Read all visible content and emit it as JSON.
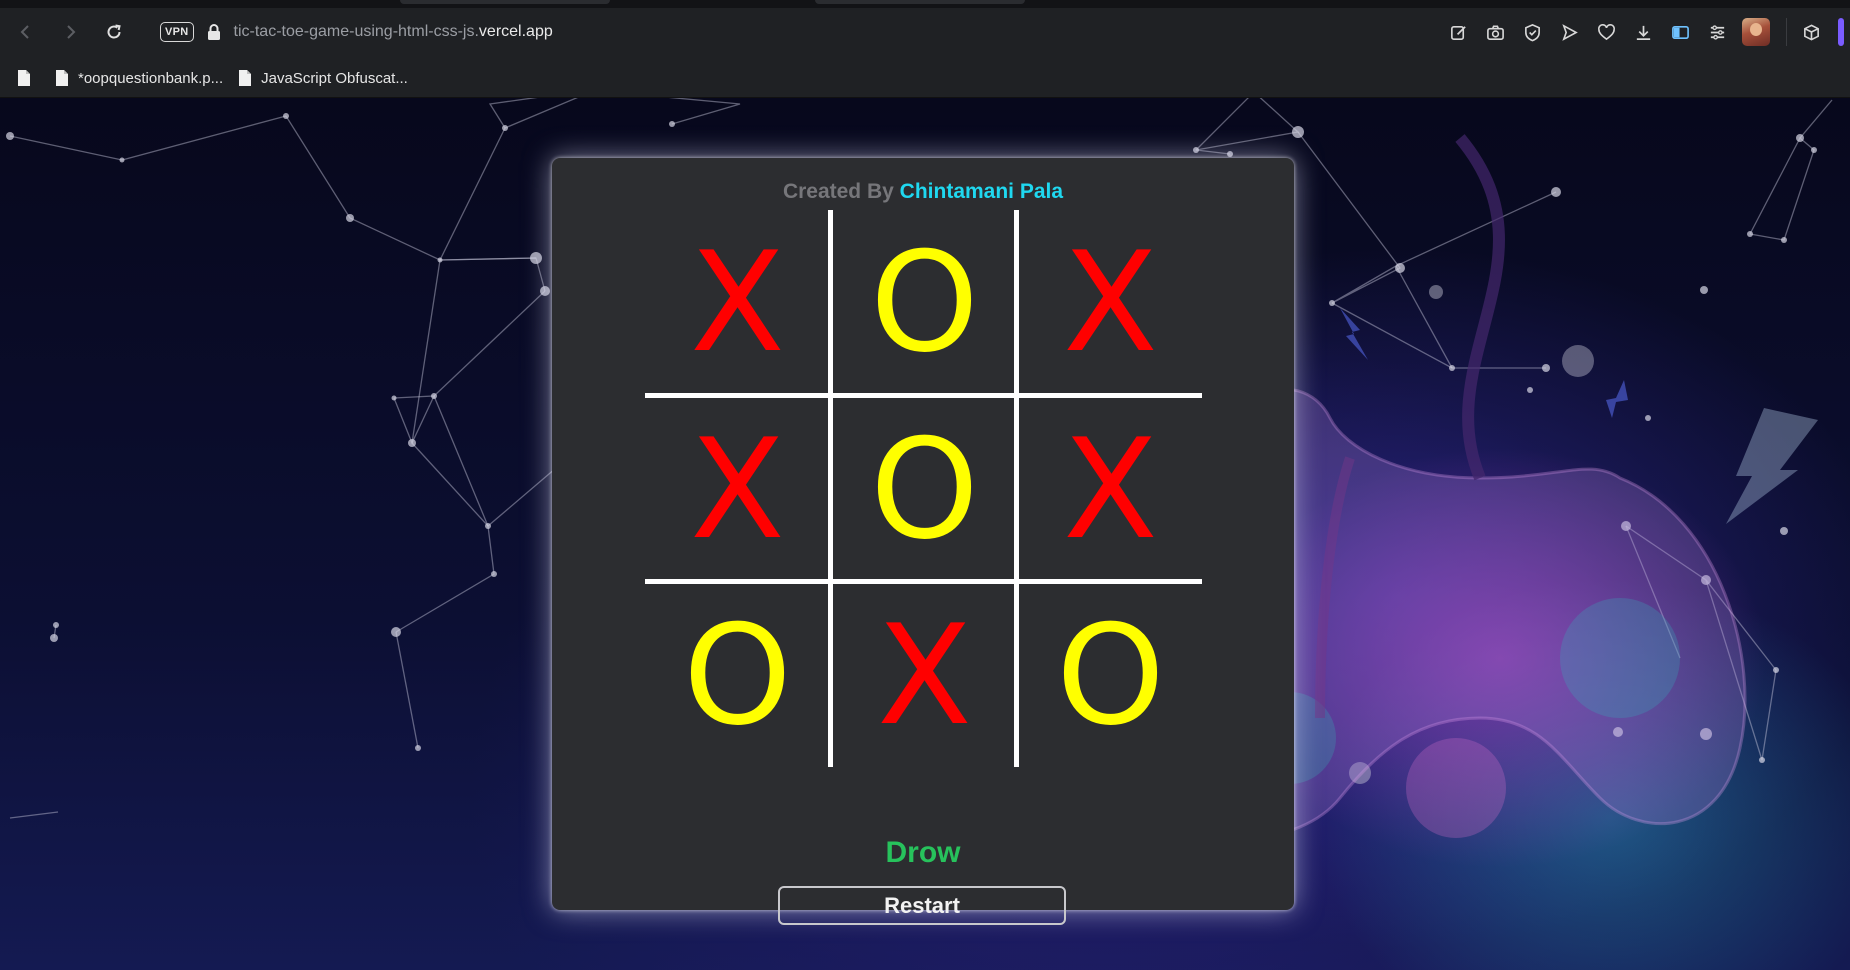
{
  "browser": {
    "vpn_label": "VPN",
    "url_prefix": "tic-tac-toe-game-using-html-css-js.",
    "url_domain": "vercel.app",
    "bookmarks": [
      {
        "label": ""
      },
      {
        "label": "*oopquestionbank.p..."
      },
      {
        "label": "JavaScript Obfuscat..."
      }
    ],
    "toolbar_icons": [
      "edit-icon",
      "camera-icon",
      "shield-icon",
      "send-icon",
      "heart-icon",
      "download-icon",
      "sidebar-icon",
      "menu-icon",
      "profile-avatar",
      "box-icon"
    ]
  },
  "game": {
    "credit_prefix": "Created By",
    "credit_name": "Chintamani Pala",
    "cells": [
      "X",
      "O",
      "X",
      "X",
      "O",
      "X",
      "O",
      "X",
      "O"
    ],
    "status": "Drow",
    "restart_label": "Restart",
    "colors": {
      "x": "#ff0000",
      "o": "#ffff00",
      "name": "#1fd8f0",
      "status": "#27c25c",
      "card": "#2c2d30"
    }
  }
}
